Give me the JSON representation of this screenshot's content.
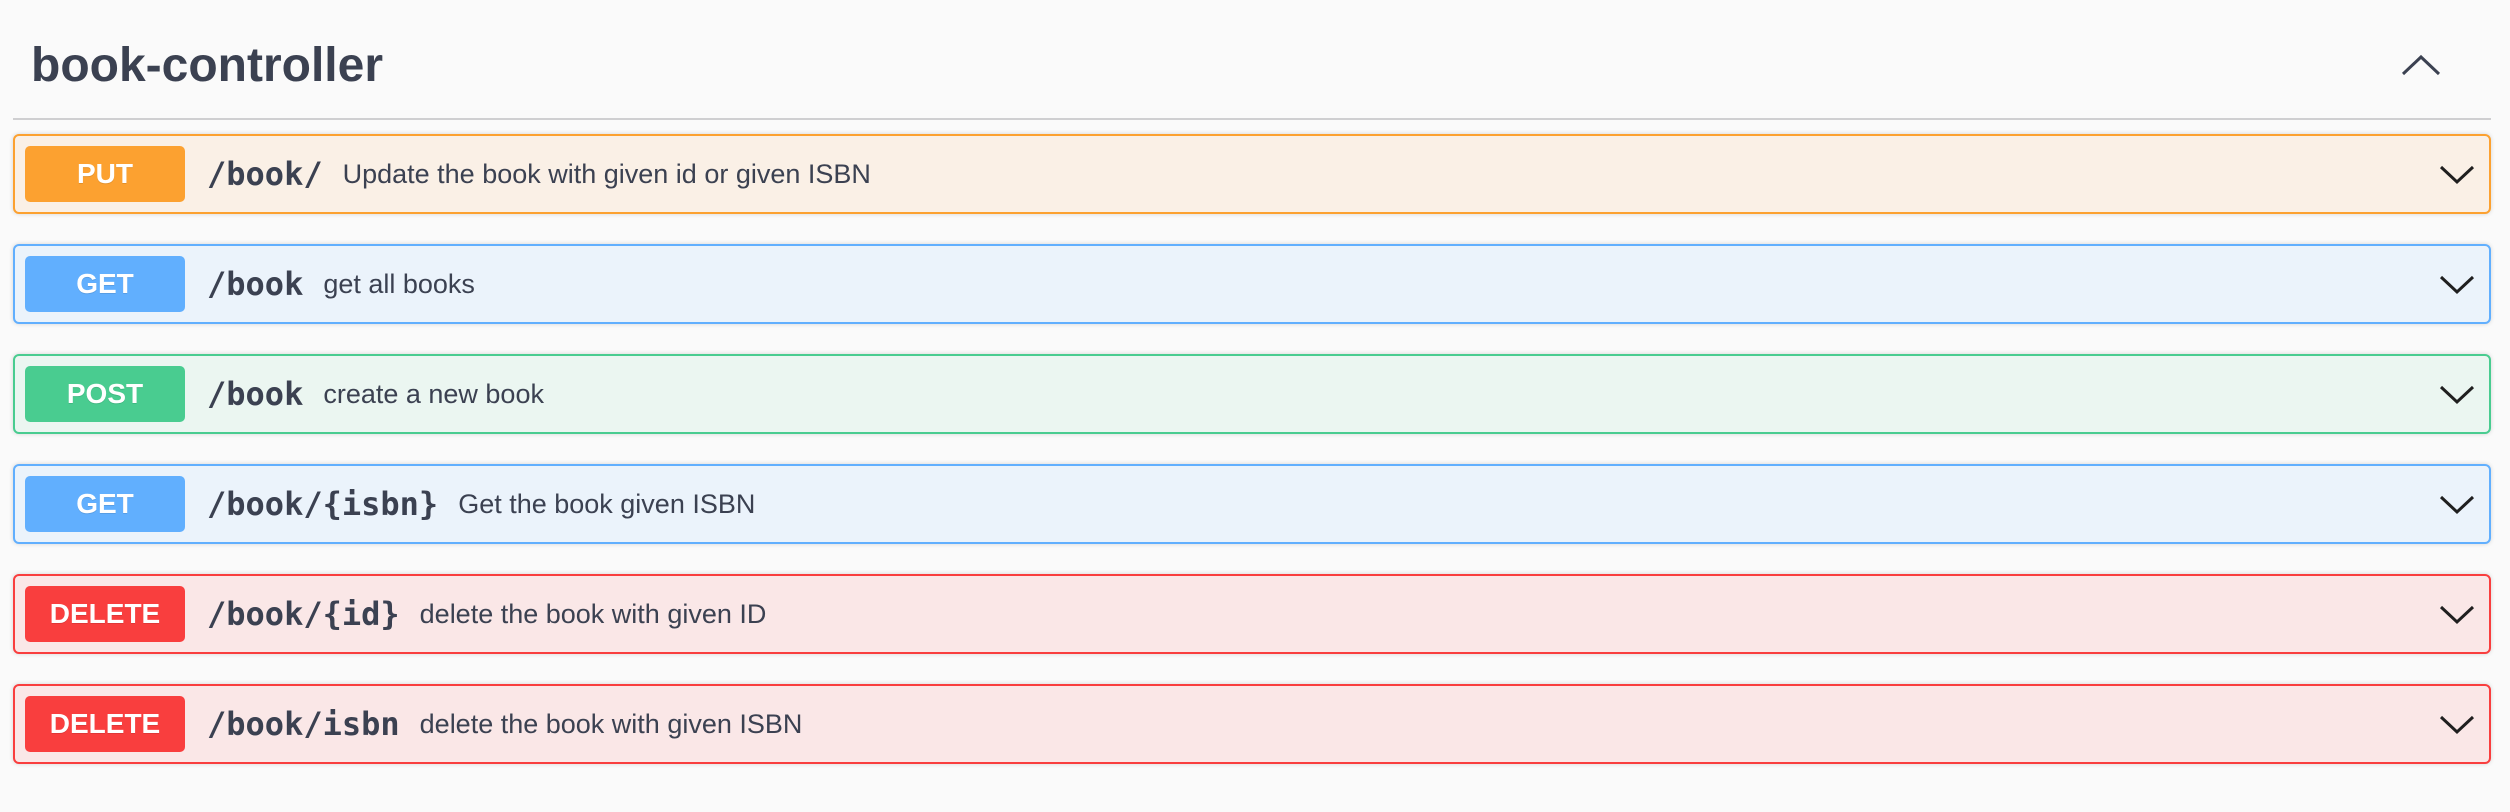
{
  "tag": {
    "title": "book-controller",
    "collapse_icon": "chevron-up-icon"
  },
  "operations": [
    {
      "method": "PUT",
      "path": "/book/",
      "summary": "Update the book with given id or given ISBN",
      "kind": "put"
    },
    {
      "method": "GET",
      "path": "/book",
      "summary": "get all books",
      "kind": "get"
    },
    {
      "method": "POST",
      "path": "/book",
      "summary": "create a new book",
      "kind": "post"
    },
    {
      "method": "GET",
      "path": "/book/{isbn}",
      "summary": "Get the book given ISBN",
      "kind": "get"
    },
    {
      "method": "DELETE",
      "path": "/book/{id}",
      "summary": "delete the book with given ID",
      "kind": "delete"
    },
    {
      "method": "DELETE",
      "path": "/book/isbn",
      "summary": "delete the book with given ISBN",
      "kind": "delete"
    }
  ],
  "colors": {
    "put": "#fca130",
    "get": "#61affe",
    "post": "#49cc90",
    "delete": "#f93e3e",
    "text": "#3b4151"
  },
  "expand_icon": "chevron-down-icon"
}
